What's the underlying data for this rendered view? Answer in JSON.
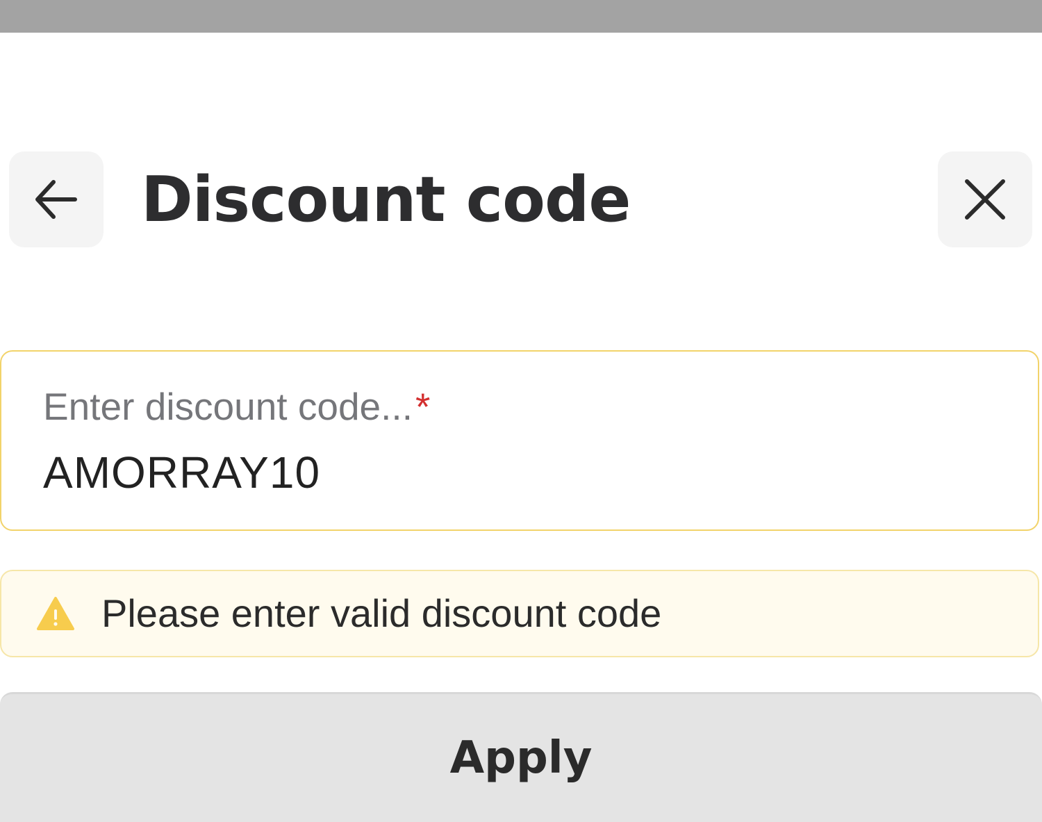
{
  "header": {
    "title": "Discount code",
    "back_icon": "arrow-left-icon",
    "close_icon": "close-icon"
  },
  "discount_field": {
    "label": "Enter discount code...",
    "required_mark": "*",
    "value": "AMORRAY10"
  },
  "warning": {
    "icon": "warning-triangle-icon",
    "message": "Please enter valid discount code"
  },
  "apply_button": {
    "label": "Apply"
  },
  "colors": {
    "field_border": "#f2d36a",
    "warning_background": "#fffbee",
    "warning_icon": "#f7cc4d",
    "required_mark": "#d32f2f",
    "button_background": "#e4e4e4"
  }
}
